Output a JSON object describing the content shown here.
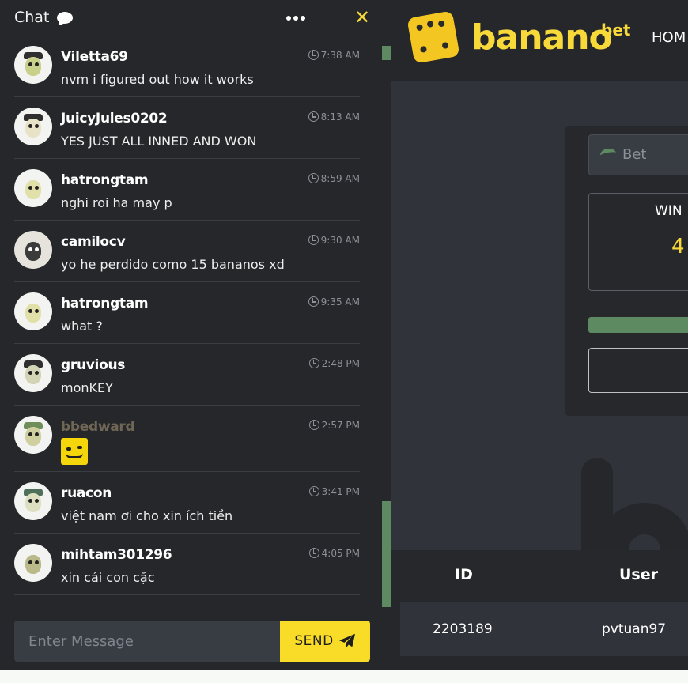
{
  "chat": {
    "title": "Chat",
    "icons": {
      "bubble": "chat-bubble-icon",
      "menu": "ellipsis-icon",
      "close": "close-x-icon",
      "clock": "clock-icon",
      "send": "paper-plane-icon"
    },
    "messages": [
      {
        "user": "Viletta69",
        "time": "7:38 AM",
        "text": "nvm i figured out how it works"
      },
      {
        "user": "JuicyJules0202",
        "time": "8:13 AM",
        "text": "YES JUST ALL INNED AND WON"
      },
      {
        "user": "hatrongtam",
        "time": "8:59 AM",
        "text": "nghi roi ha may p"
      },
      {
        "user": "camilocv",
        "time": "9:30 AM",
        "text": "yo he perdido como 15 bananos xd"
      },
      {
        "user": "hatrongtam",
        "time": "9:35 AM",
        "text": "what ?"
      },
      {
        "user": "gruvious",
        "time": "2:48 PM",
        "text": "monKEY"
      },
      {
        "user": "bbedward",
        "time": "2:57 PM",
        "text": ""
      },
      {
        "user": "ruacon",
        "time": "3:41 PM",
        "text": "việt nam ơi cho xin ích tiền"
      },
      {
        "user": "mihtam301296",
        "time": "4:05 PM",
        "text": "xin cái con cặc"
      }
    ],
    "input_placeholder": "Enter Message",
    "send_label": "SEND"
  },
  "site": {
    "brand": "banano",
    "brand_sup": "bet",
    "nav_home": "HOM",
    "bet_placeholder": "Bet",
    "win_label": "WIN",
    "win_value": "4",
    "table": {
      "headers": [
        "ID",
        "User"
      ],
      "rows": [
        [
          "2203189",
          "pvtuan97"
        ]
      ]
    }
  },
  "colors": {
    "accent": "#f8d93a",
    "green": "#5e8a62",
    "bg": "#25272b"
  }
}
